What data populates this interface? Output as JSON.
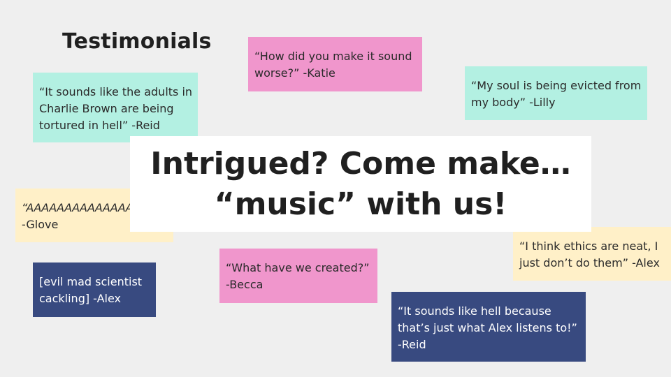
{
  "slide": {
    "title": "Testimonials",
    "background_color": "#efefef"
  },
  "notes": [
    {
      "id": "reid-1",
      "color": "#b3f0e2",
      "lines": [
        "“It sounds like the adults in",
        "Charlie Brown are being",
        "tortured in hell” -Reid"
      ]
    },
    {
      "id": "katie",
      "color": "#f096cc",
      "lines": [
        "“How did you make it sound",
        "worse?” -Katie"
      ]
    },
    {
      "id": "lilly",
      "color": "#b3f0e2",
      "lines": [
        "“My soul is being evicted from",
        "my body” -Lilly"
      ]
    },
    {
      "id": "glove",
      "color": "#fff0c8",
      "lines": [
        "“AAAAAAAAAAAAAAAAA”",
        "-Glove"
      ]
    },
    {
      "id": "alex-ethics",
      "color": "#fff0c8",
      "lines": [
        "“I think ethics are neat, I",
        "just don’t do them” -Alex"
      ]
    },
    {
      "id": "becca",
      "color": "#f096cc",
      "lines": [
        "“What have we created?”",
        "-Becca"
      ]
    },
    {
      "id": "alex-cackling",
      "color": "#384a80",
      "lines": [
        "[evil mad scientist",
        "cackling] -Alex"
      ]
    },
    {
      "id": "reid-2",
      "color": "#384a80",
      "lines": [
        "“It sounds like hell because",
        "that’s just what Alex listens to!”",
        "-Reid"
      ]
    }
  ],
  "banner": {
    "line1": "Intrigued? Come make…",
    "line2": "“music” with us!"
  }
}
